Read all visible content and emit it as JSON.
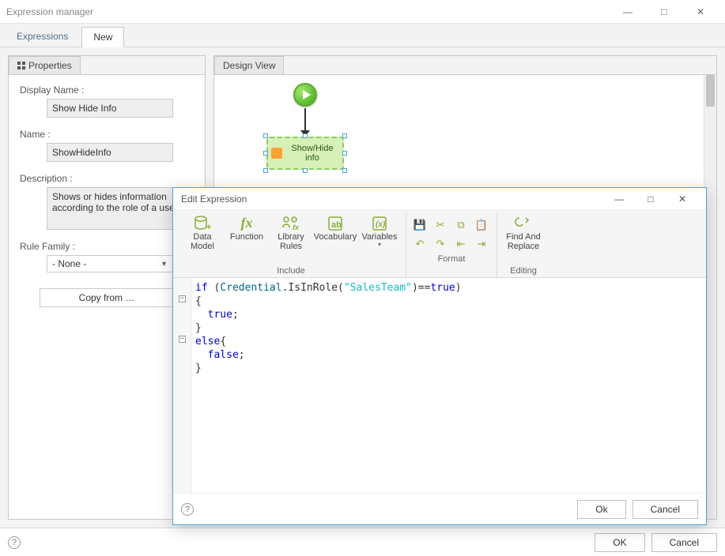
{
  "window": {
    "title": "Expression manager",
    "min_label": "—",
    "max_label": "□",
    "close_label": "✕"
  },
  "main_tabs": {
    "expressions": "Expressions",
    "new": "New"
  },
  "left_panel": {
    "tab": "Properties",
    "display_name_label": "Display Name :",
    "display_name_value": "Show Hide Info",
    "name_label": "Name :",
    "name_value": "ShowHideInfo",
    "description_label": "Description :",
    "description_value": "Shows or hides information according to the role of a user",
    "rule_family_label": "Rule Family :",
    "rule_family_value": "- None -",
    "copy_from": "Copy from …"
  },
  "design_panel": {
    "tab": "Design View",
    "activity_label": "Show/Hide info"
  },
  "modal": {
    "title": "Edit Expression",
    "ribbon": {
      "data_model": "Data Model",
      "function": "Function",
      "library_rules": "Library Rules",
      "vocabulary": "Vocabulary",
      "variables": "Variables",
      "include_label": "Include",
      "format_label": "Format",
      "find_replace": "Find And Replace",
      "editing_label": "Editing"
    },
    "code": {
      "l1_if": "if",
      "l1_open": " (",
      "l1_cred": "Credential",
      "l1_dot": ".IsInRole(",
      "l1_str": "\"SalesTeam\"",
      "l1_close": ")==",
      "l1_true": "true",
      "l1_paren": ")",
      "l2": "{",
      "l3_true": "true",
      "l3_semi": ";",
      "l4": "}",
      "l5_else": "else",
      "l5_brace": "{",
      "l6_false": "false",
      "l6_semi": ";",
      "l7": "}"
    },
    "ok": "Ok",
    "cancel": "Cancel"
  },
  "main_buttons": {
    "ok": "OK",
    "cancel": "Cancel"
  }
}
